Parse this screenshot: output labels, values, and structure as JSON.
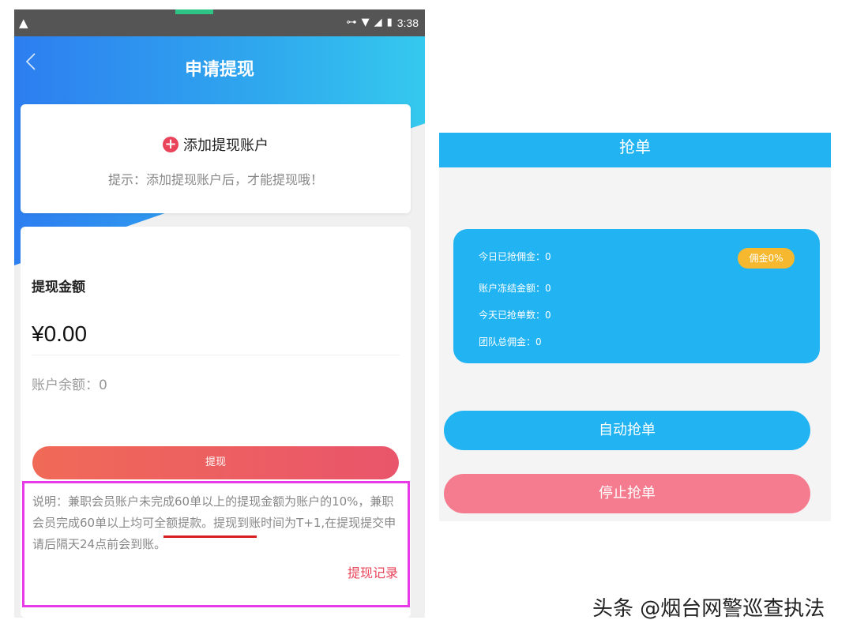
{
  "left_screen": {
    "status_bar": {
      "warning_glyph": "▲",
      "key_glyph": "⊶",
      "wifi_glyph": "▼",
      "signal_glyph": "◢",
      "battery_glyph": "▮",
      "time": "3:38"
    },
    "nav": {
      "title": "申请提现"
    },
    "add_account": {
      "label": "添加提现账户",
      "hint": "提示：添加提现账户后，才能提现哦！"
    },
    "amount": {
      "label": "提现金额",
      "value": "¥0.00",
      "balance": "账户余额：0"
    },
    "withdraw_button": "提现",
    "note": "说明：兼职会员账户未完成60单以上的提现金额为账户的10%，兼职会员完成60单以上均可全额提款。提现到账时间为T+1,在提现提交申请后隔天24点前会到账。",
    "record_link": "提现记录"
  },
  "right_screen": {
    "title": "抢单",
    "info": {
      "today_commission": "今日已抢佣金：0",
      "frozen_amount": "账户冻结金额：0",
      "today_orders": "今天已抢单数：0",
      "team_commission": "团队总佣金：0",
      "badge": "佣金0%"
    },
    "auto_button": "自动抢单",
    "stop_button": "停止抢单"
  },
  "watermark": "头条 @烟台网警巡查执法",
  "colors": {
    "nav_blue": "#2d7ef0",
    "accent_red": "#e9445a",
    "note_border": "#e63be6",
    "right_blue": "#22b4f2",
    "badge_orange": "#f5b82e",
    "stop_pink": "#f57b8e"
  }
}
